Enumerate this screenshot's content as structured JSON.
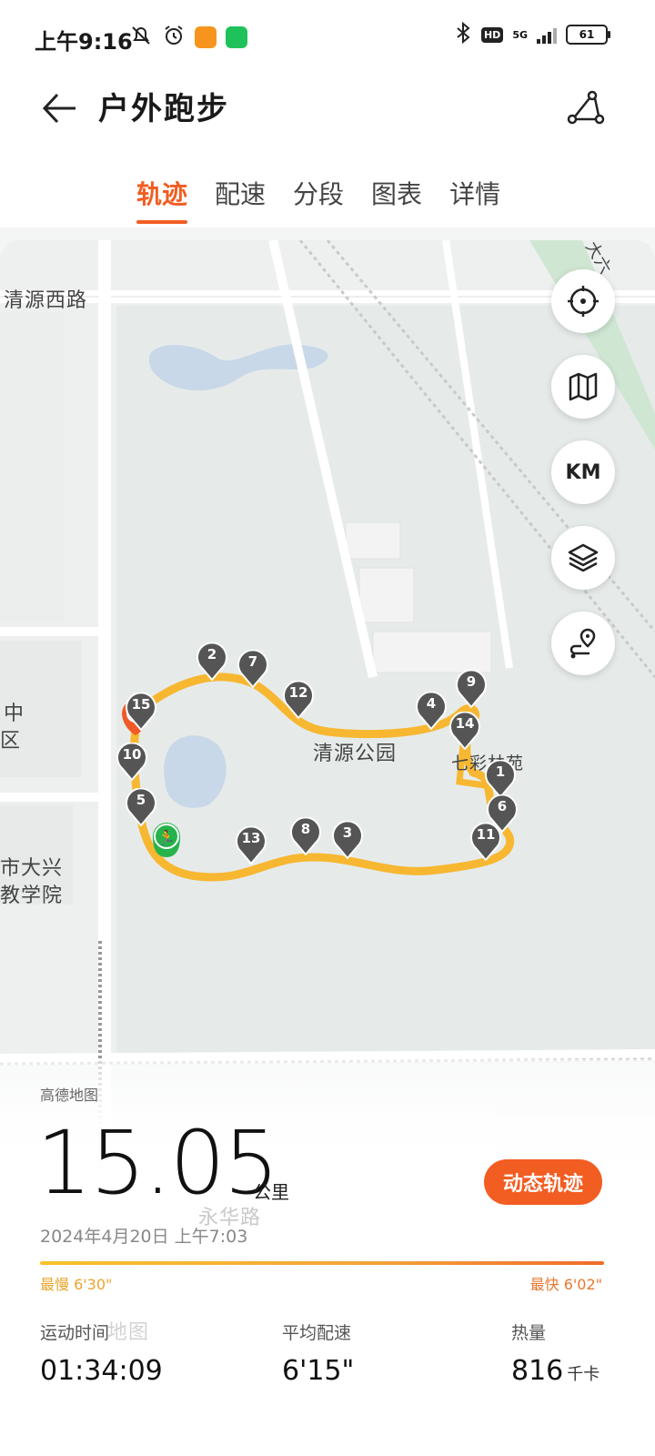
{
  "status_bar": {
    "time": "上午9:16",
    "network": "5G",
    "hd": "HD",
    "battery": "61"
  },
  "header": {
    "title": "户外跑步",
    "tabs": [
      {
        "label": "轨迹",
        "active": true
      },
      {
        "label": "配速",
        "active": false
      },
      {
        "label": "分段",
        "active": false
      },
      {
        "label": "图表",
        "active": false
      },
      {
        "label": "详情",
        "active": false
      }
    ]
  },
  "map": {
    "labels": {
      "road_top": "清源西路",
      "park": "清源公园",
      "garden": "七彩林苑",
      "left_top": "中",
      "left_mid": "区",
      "left_bottom_1": "市大兴",
      "left_bottom_2": "教学院",
      "top_right": "大六",
      "road_bottom": "永华路",
      "map_ghost": "地图"
    },
    "controls": {
      "locate": "crosshair-icon",
      "map_type": "map-icon",
      "km": "KM",
      "layers": "layers-icon",
      "route": "route-pin-icon"
    },
    "route_color": "#f7b731",
    "km_markers": [
      "1",
      "2",
      "3",
      "4",
      "5",
      "6",
      "7",
      "8",
      "9",
      "10",
      "11",
      "12",
      "13",
      "14",
      "15"
    ]
  },
  "summary": {
    "map_provider": "高德地图",
    "distance": "15.05",
    "distance_unit": "公里",
    "replay_button": "动态轨迹",
    "datetime": "2024年4月20日 上午7:03",
    "pace_slowest": "最慢 6'30\"",
    "pace_fastest": "最快 6'02\"",
    "stats": [
      {
        "label": "运动时间",
        "value": "01:34:09",
        "unit": ""
      },
      {
        "label": "平均配速",
        "value": "6'15\"",
        "unit": ""
      },
      {
        "label": "热量",
        "value": "816",
        "unit": "千卡"
      }
    ]
  },
  "colors": {
    "accent": "#f25d22",
    "route": "#f7b731",
    "marker": "#555555"
  }
}
